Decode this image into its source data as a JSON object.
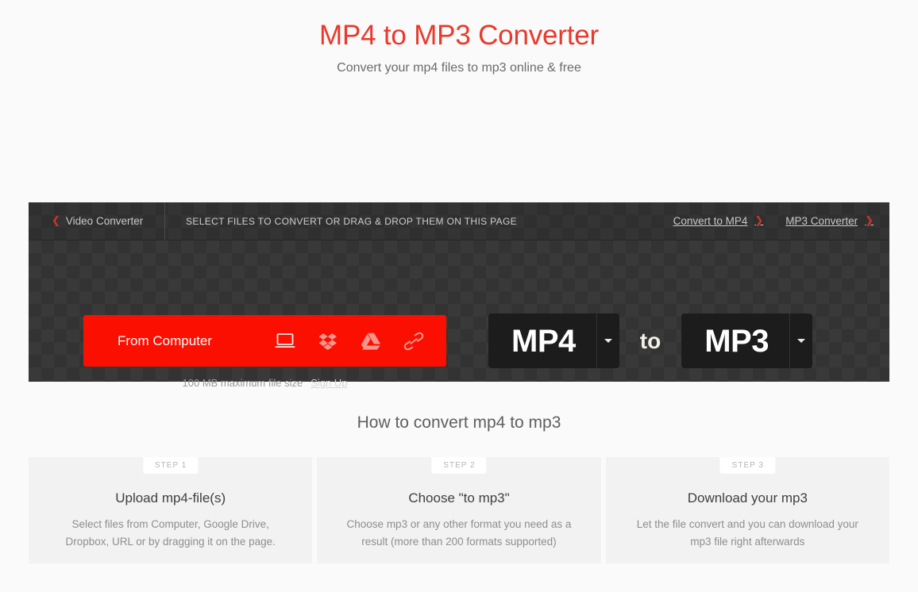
{
  "hero": {
    "title": "MP4 to MP3 Converter",
    "subtitle": "Convert your mp4 files to mp3 online & free",
    "title_color": "#e8392c"
  },
  "toolbar": {
    "back_label": "Video Converter",
    "back_chevron": "chevron-left-icon",
    "drop_hint": "SELECT FILES TO CONVERT OR DRAG & DROP THEM ON THIS PAGE",
    "links": [
      {
        "label": "Convert to MP4",
        "chevron": "chevron-right-icon"
      },
      {
        "label": "MP3 Converter",
        "chevron": "chevron-right-icon"
      }
    ]
  },
  "uploader": {
    "button_label": "From Computer",
    "button_color": "#fa0f00",
    "sources": [
      {
        "name": "computer-icon",
        "title": "From Computer"
      },
      {
        "name": "dropbox-icon",
        "title": "Dropbox"
      },
      {
        "name": "google-drive-icon",
        "title": "Google Drive"
      },
      {
        "name": "link-icon",
        "title": "From URL"
      }
    ],
    "size_note": "100 MB maximum file size",
    "signup_label": "Sign Up"
  },
  "formats": {
    "source": "MP4",
    "separator": "to",
    "target": "MP3"
  },
  "howto": {
    "title": "How to convert mp4 to mp3",
    "steps": [
      {
        "badge": "STEP 1",
        "title": "Upload mp4-file(s)",
        "desc": "Select files from Computer, Google Drive, Dropbox, URL or by dragging it on the page."
      },
      {
        "badge": "STEP 2",
        "title": "Choose \"to mp3\"",
        "desc": "Choose mp3 or any other format you need as a result (more than 200 formats supported)"
      },
      {
        "badge": "STEP 3",
        "title": "Download your mp3",
        "desc": "Let the file convert and you can download your mp3 file right afterwards"
      }
    ]
  }
}
